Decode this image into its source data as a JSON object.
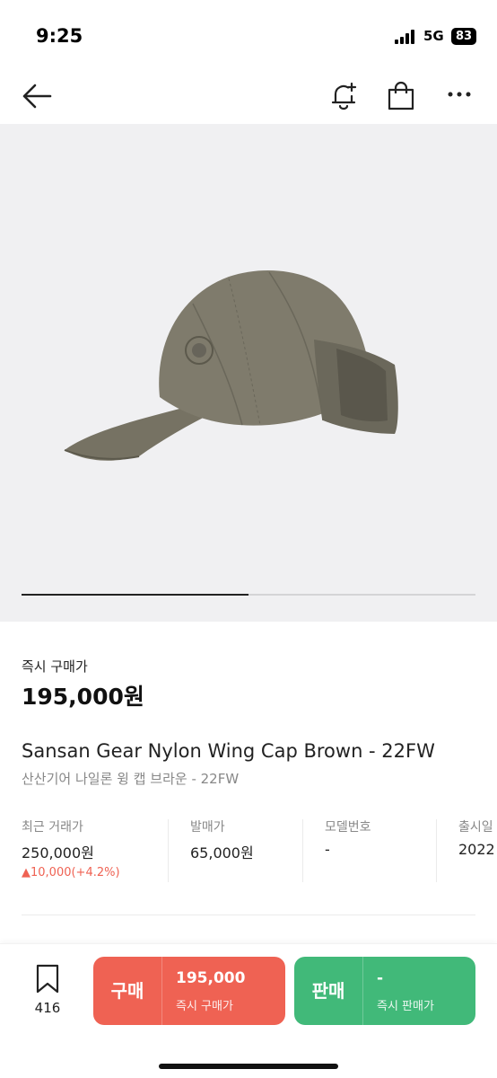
{
  "status": {
    "time": "9:25",
    "network": "5G",
    "battery": "83"
  },
  "nav": {
    "back_icon": "arrow-left-icon",
    "alert_icon": "bell-plus-icon",
    "bag_icon": "shopping-bag-icon",
    "more_icon": "more-dots-icon"
  },
  "gallery": {
    "progress": 0.5
  },
  "price": {
    "label": "즉시 구매가",
    "value": "195,000원"
  },
  "product": {
    "title_en": "Sansan Gear Nylon Wing Cap Brown - 22FW",
    "title_ko": "산산기어 나일론 윙 캡 브라운 - 22FW"
  },
  "info": {
    "recent": {
      "label": "최근 거래가",
      "value": "250,000원",
      "change": "▲10,000(+4.2%)"
    },
    "release_price": {
      "label": "발매가",
      "value": "65,000원"
    },
    "model": {
      "label": "모델번호",
      "value": "-"
    },
    "release_date": {
      "label": "출시일",
      "value": "2022"
    }
  },
  "bottom": {
    "wish_count": "416",
    "buy": {
      "kind": "구매",
      "amount": "195,000",
      "sub": "즉시 구매가"
    },
    "sell": {
      "kind": "판매",
      "amount": "-",
      "sub": "즉시 판매가"
    }
  },
  "colors": {
    "buy": "#ef6253",
    "sell": "#41b979",
    "rise": "#ef6253"
  }
}
